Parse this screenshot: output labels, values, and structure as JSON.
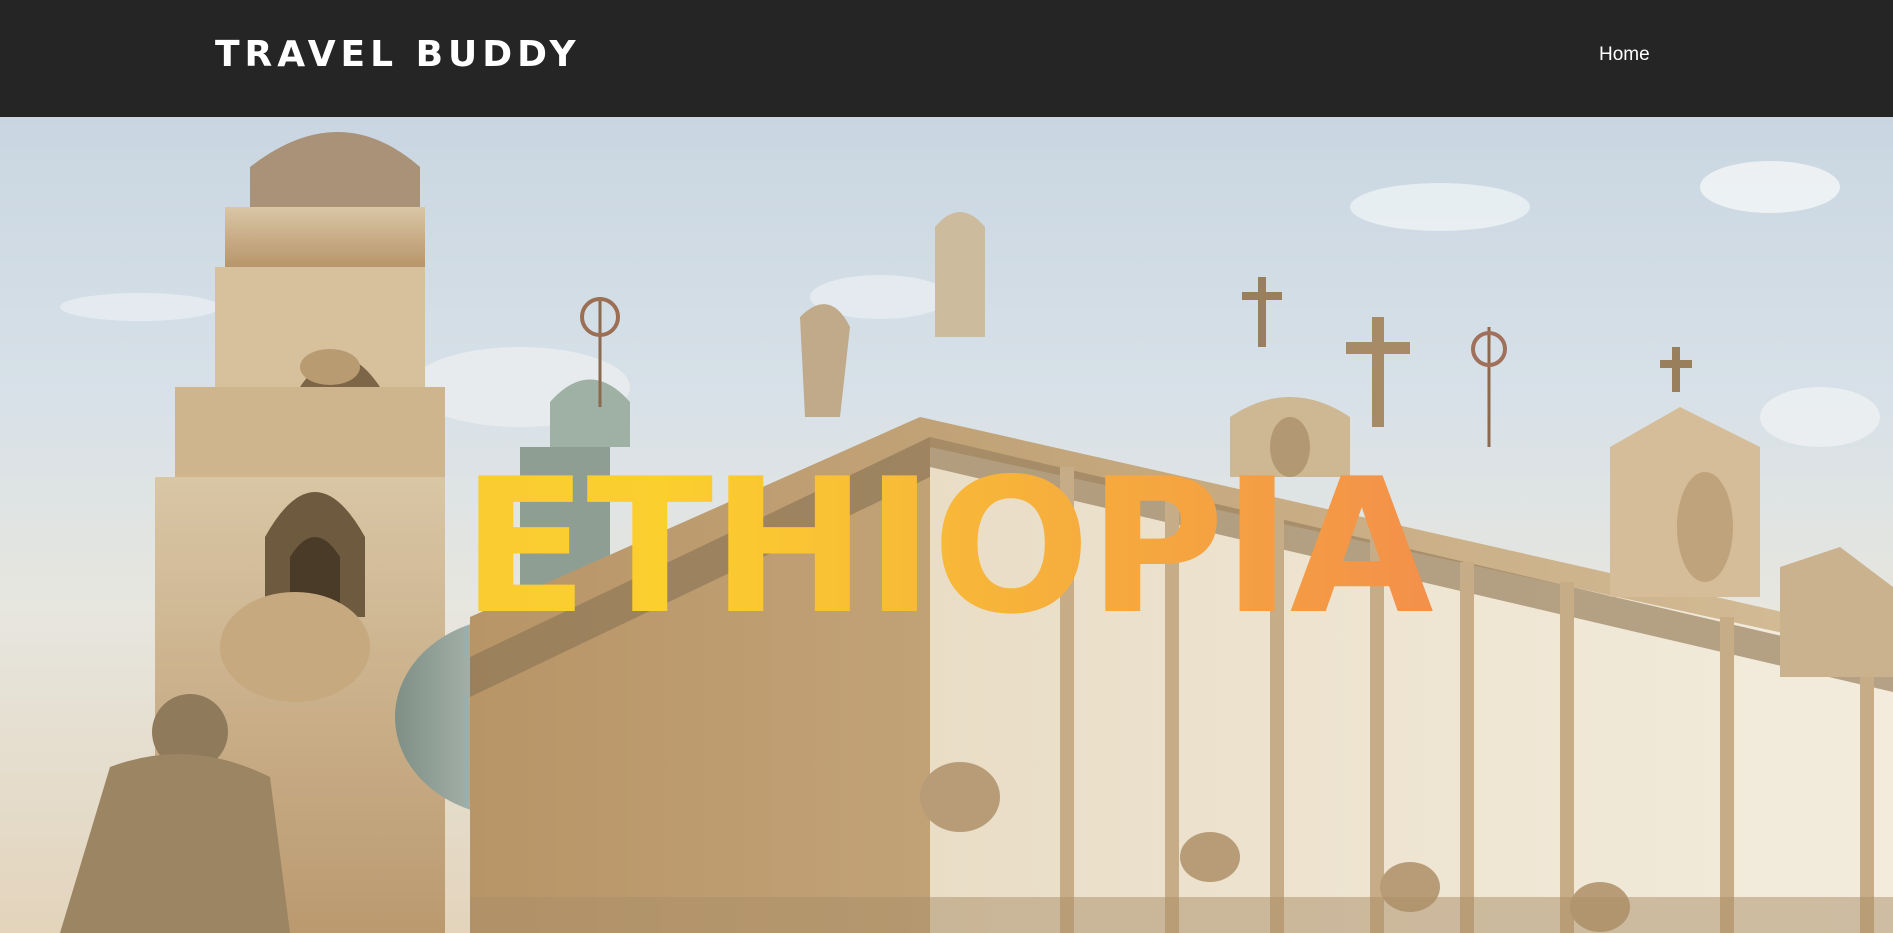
{
  "header": {
    "brand": "TRAVEL BUDDY",
    "nav": [
      {
        "label": "Home"
      }
    ]
  },
  "hero": {
    "title": "ETHIOPIA",
    "image_subject": "cathedral-facade-photo"
  },
  "colors": {
    "navbar_bg": "#252525",
    "nav_text": "#ffffff",
    "title_gradient_start": "#f7c33f",
    "title_gradient_mid": "#fbcf2e",
    "title_gradient_end": "#f06a5c"
  }
}
